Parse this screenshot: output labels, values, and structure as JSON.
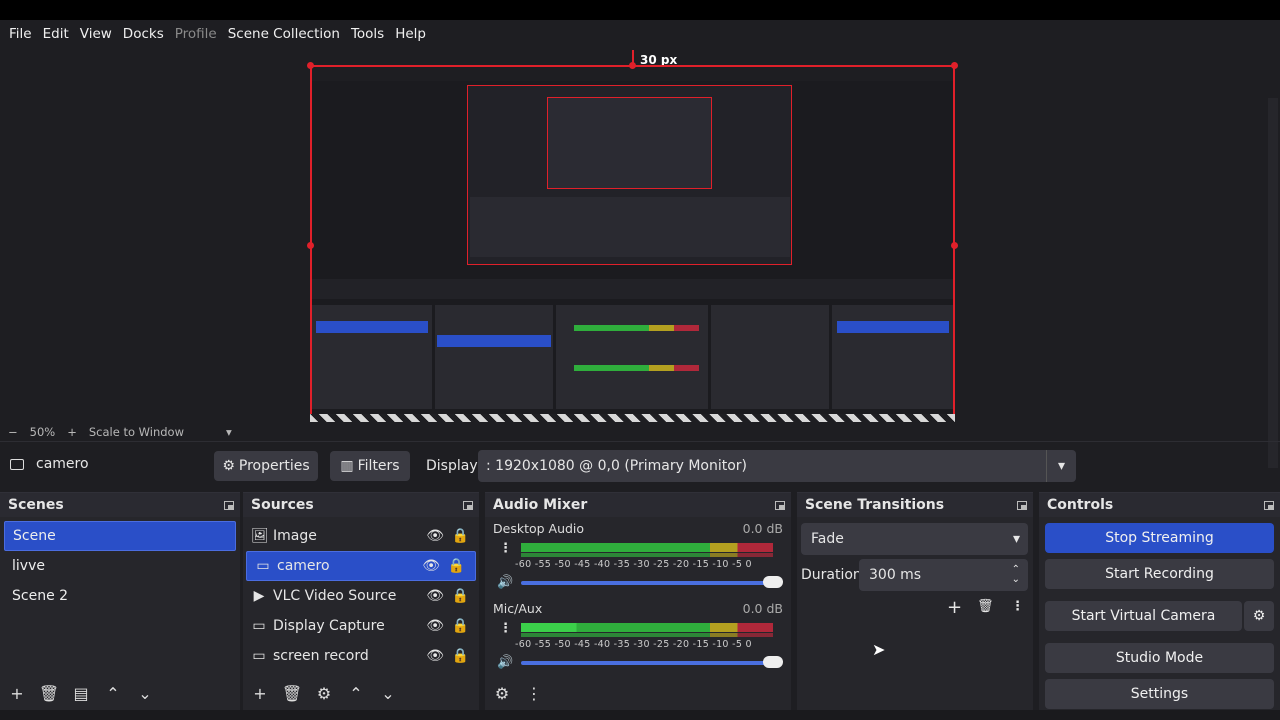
{
  "menu": [
    "File",
    "Edit",
    "View",
    "Docks",
    "Profile",
    "Scene Collection",
    "Tools",
    "Help"
  ],
  "menu_disabled": [
    "Profile"
  ],
  "preview": {
    "px_readout": "30 px"
  },
  "zoom": {
    "minus": "−",
    "level": "50%",
    "plus": "+",
    "mode": "Scale to Window"
  },
  "toolbar": {
    "source_name": "camero",
    "properties_label": "Properties",
    "filters_label": "Filters",
    "display_label": "Display",
    "display_value": ": 1920x1080 @ 0,0 (Primary Monitor)"
  },
  "scenes": {
    "title": "Scenes",
    "items": [
      "Scene",
      "livve",
      "Scene 2"
    ],
    "selected": "Scene"
  },
  "sources": {
    "title": "Sources",
    "items": [
      {
        "name": "Image",
        "icon": "image-icon"
      },
      {
        "name": "camero",
        "icon": "monitor-icon"
      },
      {
        "name": "VLC Video Source",
        "icon": "play-icon"
      },
      {
        "name": "Display Capture",
        "icon": "monitor-icon"
      },
      {
        "name": "screen record",
        "icon": "monitor-icon"
      }
    ],
    "selected": "camero"
  },
  "mixer": {
    "title": "Audio Mixer",
    "ticks": "-60 -55 -50 -45 -40 -35 -30 -25 -20 -15 -10 -5 0",
    "channels": [
      {
        "name": "Desktop Audio",
        "db": "0.0 dB",
        "level": 1.0
      },
      {
        "name": "Mic/Aux",
        "db": "0.0 dB",
        "level": 1.0
      }
    ]
  },
  "transitions": {
    "title": "Scene Transitions",
    "type": "Fade",
    "duration_label": "Duration",
    "duration_value": "300 ms"
  },
  "controls": {
    "title": "Controls",
    "stop_streaming": "Stop Streaming",
    "start_recording": "Start Recording",
    "start_virtual_camera": "Start Virtual Camera",
    "studio_mode": "Studio Mode",
    "settings": "Settings"
  },
  "colors": {
    "accent": "#2a4fc8",
    "selection_border": "#e0202a",
    "meter_green": "#2fae3c",
    "meter_yellow": "#b4a020",
    "meter_red": "#b0283a"
  }
}
